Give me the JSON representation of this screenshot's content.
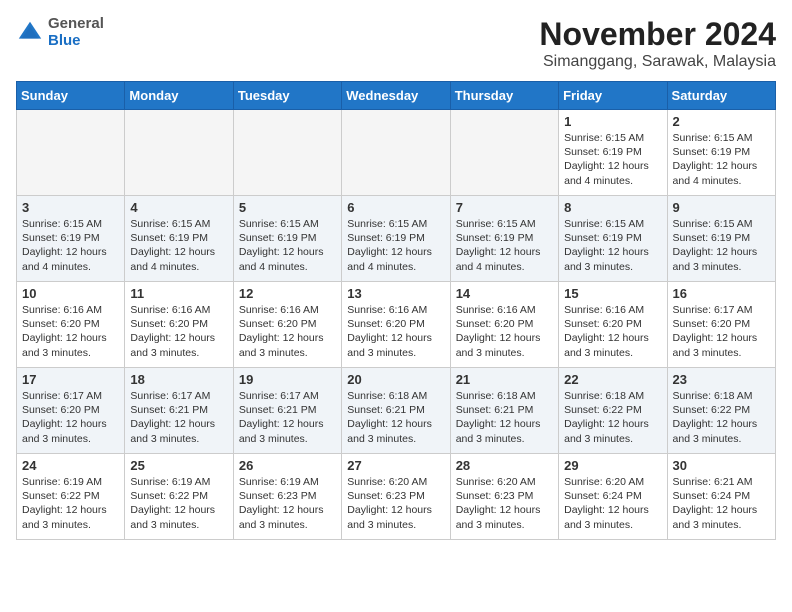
{
  "logo": {
    "general": "General",
    "blue": "Blue"
  },
  "title": "November 2024",
  "subtitle": "Simanggang, Sarawak, Malaysia",
  "days_of_week": [
    "Sunday",
    "Monday",
    "Tuesday",
    "Wednesday",
    "Thursday",
    "Friday",
    "Saturday"
  ],
  "weeks": [
    {
      "row_alt": false,
      "days": [
        {
          "num": "",
          "empty": true,
          "info": ""
        },
        {
          "num": "",
          "empty": true,
          "info": ""
        },
        {
          "num": "",
          "empty": true,
          "info": ""
        },
        {
          "num": "",
          "empty": true,
          "info": ""
        },
        {
          "num": "",
          "empty": true,
          "info": ""
        },
        {
          "num": "1",
          "empty": false,
          "info": "Sunrise: 6:15 AM\nSunset: 6:19 PM\nDaylight: 12 hours and 4 minutes."
        },
        {
          "num": "2",
          "empty": false,
          "info": "Sunrise: 6:15 AM\nSunset: 6:19 PM\nDaylight: 12 hours and 4 minutes."
        }
      ]
    },
    {
      "row_alt": true,
      "days": [
        {
          "num": "3",
          "empty": false,
          "info": "Sunrise: 6:15 AM\nSunset: 6:19 PM\nDaylight: 12 hours and 4 minutes."
        },
        {
          "num": "4",
          "empty": false,
          "info": "Sunrise: 6:15 AM\nSunset: 6:19 PM\nDaylight: 12 hours and 4 minutes."
        },
        {
          "num": "5",
          "empty": false,
          "info": "Sunrise: 6:15 AM\nSunset: 6:19 PM\nDaylight: 12 hours and 4 minutes."
        },
        {
          "num": "6",
          "empty": false,
          "info": "Sunrise: 6:15 AM\nSunset: 6:19 PM\nDaylight: 12 hours and 4 minutes."
        },
        {
          "num": "7",
          "empty": false,
          "info": "Sunrise: 6:15 AM\nSunset: 6:19 PM\nDaylight: 12 hours and 4 minutes."
        },
        {
          "num": "8",
          "empty": false,
          "info": "Sunrise: 6:15 AM\nSunset: 6:19 PM\nDaylight: 12 hours and 3 minutes."
        },
        {
          "num": "9",
          "empty": false,
          "info": "Sunrise: 6:15 AM\nSunset: 6:19 PM\nDaylight: 12 hours and 3 minutes."
        }
      ]
    },
    {
      "row_alt": false,
      "days": [
        {
          "num": "10",
          "empty": false,
          "info": "Sunrise: 6:16 AM\nSunset: 6:20 PM\nDaylight: 12 hours and 3 minutes."
        },
        {
          "num": "11",
          "empty": false,
          "info": "Sunrise: 6:16 AM\nSunset: 6:20 PM\nDaylight: 12 hours and 3 minutes."
        },
        {
          "num": "12",
          "empty": false,
          "info": "Sunrise: 6:16 AM\nSunset: 6:20 PM\nDaylight: 12 hours and 3 minutes."
        },
        {
          "num": "13",
          "empty": false,
          "info": "Sunrise: 6:16 AM\nSunset: 6:20 PM\nDaylight: 12 hours and 3 minutes."
        },
        {
          "num": "14",
          "empty": false,
          "info": "Sunrise: 6:16 AM\nSunset: 6:20 PM\nDaylight: 12 hours and 3 minutes."
        },
        {
          "num": "15",
          "empty": false,
          "info": "Sunrise: 6:16 AM\nSunset: 6:20 PM\nDaylight: 12 hours and 3 minutes."
        },
        {
          "num": "16",
          "empty": false,
          "info": "Sunrise: 6:17 AM\nSunset: 6:20 PM\nDaylight: 12 hours and 3 minutes."
        }
      ]
    },
    {
      "row_alt": true,
      "days": [
        {
          "num": "17",
          "empty": false,
          "info": "Sunrise: 6:17 AM\nSunset: 6:20 PM\nDaylight: 12 hours and 3 minutes."
        },
        {
          "num": "18",
          "empty": false,
          "info": "Sunrise: 6:17 AM\nSunset: 6:21 PM\nDaylight: 12 hours and 3 minutes."
        },
        {
          "num": "19",
          "empty": false,
          "info": "Sunrise: 6:17 AM\nSunset: 6:21 PM\nDaylight: 12 hours and 3 minutes."
        },
        {
          "num": "20",
          "empty": false,
          "info": "Sunrise: 6:18 AM\nSunset: 6:21 PM\nDaylight: 12 hours and 3 minutes."
        },
        {
          "num": "21",
          "empty": false,
          "info": "Sunrise: 6:18 AM\nSunset: 6:21 PM\nDaylight: 12 hours and 3 minutes."
        },
        {
          "num": "22",
          "empty": false,
          "info": "Sunrise: 6:18 AM\nSunset: 6:22 PM\nDaylight: 12 hours and 3 minutes."
        },
        {
          "num": "23",
          "empty": false,
          "info": "Sunrise: 6:18 AM\nSunset: 6:22 PM\nDaylight: 12 hours and 3 minutes."
        }
      ]
    },
    {
      "row_alt": false,
      "days": [
        {
          "num": "24",
          "empty": false,
          "info": "Sunrise: 6:19 AM\nSunset: 6:22 PM\nDaylight: 12 hours and 3 minutes."
        },
        {
          "num": "25",
          "empty": false,
          "info": "Sunrise: 6:19 AM\nSunset: 6:22 PM\nDaylight: 12 hours and 3 minutes."
        },
        {
          "num": "26",
          "empty": false,
          "info": "Sunrise: 6:19 AM\nSunset: 6:23 PM\nDaylight: 12 hours and 3 minutes."
        },
        {
          "num": "27",
          "empty": false,
          "info": "Sunrise: 6:20 AM\nSunset: 6:23 PM\nDaylight: 12 hours and 3 minutes."
        },
        {
          "num": "28",
          "empty": false,
          "info": "Sunrise: 6:20 AM\nSunset: 6:23 PM\nDaylight: 12 hours and 3 minutes."
        },
        {
          "num": "29",
          "empty": false,
          "info": "Sunrise: 6:20 AM\nSunset: 6:24 PM\nDaylight: 12 hours and 3 minutes."
        },
        {
          "num": "30",
          "empty": false,
          "info": "Sunrise: 6:21 AM\nSunset: 6:24 PM\nDaylight: 12 hours and 3 minutes."
        }
      ]
    }
  ]
}
